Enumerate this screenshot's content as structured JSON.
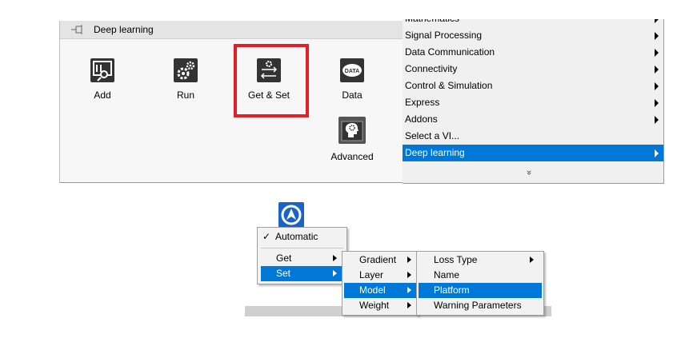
{
  "palette": {
    "title": "Deep learning",
    "tiles": {
      "add": "Add",
      "run": "Run",
      "getset": "Get & Set",
      "data": "Data",
      "data_icon_text": "DATA",
      "advanced": "Advanced"
    }
  },
  "functions_submenu": {
    "items": [
      {
        "label": "Mathematics",
        "has_submenu": true
      },
      {
        "label": "Signal Processing",
        "has_submenu": true
      },
      {
        "label": "Data Communication",
        "has_submenu": true
      },
      {
        "label": "Connectivity",
        "has_submenu": true
      },
      {
        "label": "Control & Simulation",
        "has_submenu": true
      },
      {
        "label": "Express",
        "has_submenu": true
      },
      {
        "label": "Addons",
        "has_submenu": true
      },
      {
        "label": "Select a VI...",
        "has_submenu": false
      },
      {
        "label": "Deep learning",
        "has_submenu": true,
        "selected": true
      }
    ],
    "more_chevron": "»"
  },
  "context_menu": {
    "main": {
      "automatic": "Automatic",
      "check": "✓",
      "get": "Get",
      "set": "Set"
    },
    "set_submenu": [
      "Gradient",
      "Layer",
      "Model",
      "Weight"
    ],
    "model_submenu": [
      "Loss Type",
      "Name",
      "Platform",
      "Warning Parameters"
    ]
  },
  "colors": {
    "selection": "#0078d7",
    "highlight_box": "#e41e25",
    "vi_icon": "#1864c8"
  }
}
